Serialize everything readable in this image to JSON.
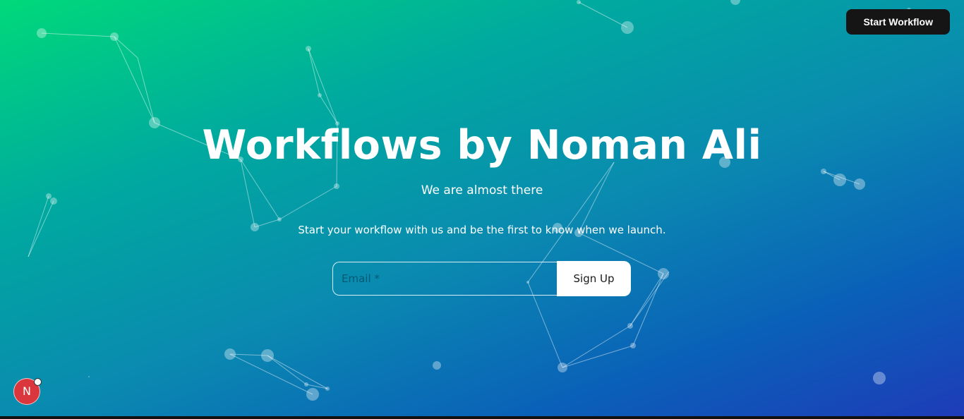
{
  "header": {
    "start_button_label": "Start Workflow"
  },
  "hero": {
    "title": "Workflows by Noman Ali",
    "subtitle": "We are almost there",
    "tagline": "Start your workflow with us and be the first to know when we launch."
  },
  "signup": {
    "email_placeholder": "Email *",
    "button_label": "Sign Up"
  },
  "avatar": {
    "initial": "N"
  },
  "colors": {
    "gradient_start": "#00d97a",
    "gradient_end": "#1e3cb8",
    "button_dark": "#151515",
    "avatar_red": "#d9363e"
  }
}
